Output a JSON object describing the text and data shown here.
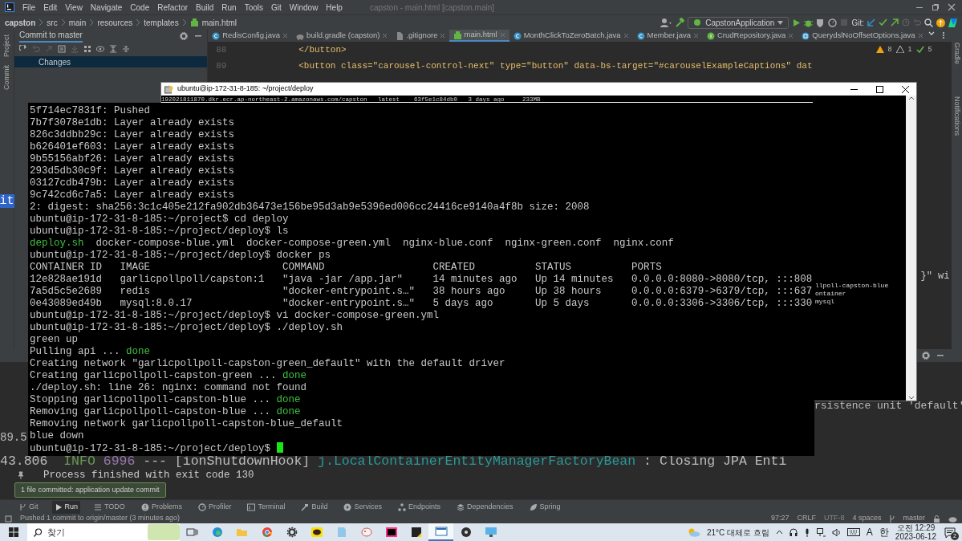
{
  "ide": {
    "menu": [
      "File",
      "Edit",
      "View",
      "Navigate",
      "Code",
      "Refactor",
      "Build",
      "Run",
      "Tools",
      "Git",
      "Window",
      "Help"
    ],
    "window_title": "capston - main.html [capston.main]",
    "breadcrumb": [
      "capston",
      "src",
      "main",
      "resources",
      "templates",
      "main.html"
    ],
    "run_config": "CapstonApplication",
    "git_label": "Git:",
    "left_stripe": [
      "Project",
      "Commit"
    ],
    "commit_panel": {
      "title": "Commit to master",
      "changes": {
        "label": "Changes",
        "selected": true
      },
      "fragment": "it"
    },
    "editor_tabs": [
      {
        "label": "RedisConfig.java",
        "kind": "class",
        "selected": false
      },
      {
        "label": "build.gradle (capston)",
        "kind": "gradle",
        "selected": false
      },
      {
        "label": ".gitignore",
        "kind": "file",
        "selected": false
      },
      {
        "label": "main.html",
        "kind": "html",
        "selected": true
      },
      {
        "label": "MonthClickToZeroBatch.java",
        "kind": "class",
        "selected": false
      },
      {
        "label": "Member.java",
        "kind": "class",
        "selected": false
      },
      {
        "label": "CrudRepository.java",
        "kind": "interface",
        "selected": false
      },
      {
        "label": "QuerydslNoOffsetOptions.java",
        "kind": "annotation",
        "selected": false
      }
    ],
    "inspections": [
      {
        "kind": "warning",
        "count": "8"
      },
      {
        "kind": "weak",
        "count": "1"
      },
      {
        "kind": "ok",
        "count": "5"
      }
    ],
    "code_lines": [
      {
        "number": "88",
        "code": "</button>"
      },
      {
        "number": "89",
        "code": "<button class=\"carousel-control-next\" type=\"button\" data-bs-target=\"#carouselExampleCaptions\" dat"
      }
    ],
    "code_fragment": "}\" wi",
    "right_stripe": [
      "Gradle",
      "Notifications"
    ],
    "run_log": [
      {
        "segments": [
          {
            "text": "rsistence unit 'default'",
            "kind": "plain"
          }
        ]
      },
      {
        "segments": [
          {
            "text": "89.5",
            "kind": "plain"
          }
        ]
      },
      {
        "segments": [
          {
            "text": "43.806  ",
            "kind": "plain"
          },
          {
            "text": "INFO",
            "kind": "info"
          },
          {
            "text": " 6996",
            "kind": "pid"
          },
          {
            "text": " --- [ionShutdownHook] ",
            "kind": "plain"
          },
          {
            "text": "j.LocalContainerEntityManagerFactoryBean",
            "kind": "logger"
          },
          {
            "text": " : Closing JPA Enti",
            "kind": "plain"
          }
        ]
      }
    ],
    "run_output": "Process finished with exit code 130",
    "tooltip": "1 file committed: application update commit",
    "tool_windows": [
      {
        "label": "Git",
        "kind": "git",
        "selected": false
      },
      {
        "label": "Run",
        "kind": "run",
        "selected": true
      },
      {
        "label": "TODO",
        "kind": "todo",
        "selected": false
      },
      {
        "label": "Problems",
        "kind": "problems",
        "selected": false
      },
      {
        "label": "Profiler",
        "kind": "profiler",
        "selected": false
      },
      {
        "label": "Terminal",
        "kind": "terminal",
        "selected": false
      },
      {
        "label": "Build",
        "kind": "build",
        "selected": false
      },
      {
        "label": "Services",
        "kind": "services",
        "selected": false
      },
      {
        "label": "Endpoints",
        "kind": "endpoints",
        "selected": false
      },
      {
        "label": "Dependencies",
        "kind": "dependencies",
        "selected": false
      },
      {
        "label": "Spring",
        "kind": "spring",
        "selected": false
      }
    ],
    "status_message": "Pushed 1 commit to origin/master (3 minutes ago)",
    "status_items": [
      {
        "text": "97:27",
        "disabled": false
      },
      {
        "text": "CRLF",
        "disabled": false
      },
      {
        "text": "UTF-8",
        "disabled": true
      },
      {
        "text": "4 spaces",
        "disabled": false
      },
      {
        "text": "master",
        "disabled": false
      }
    ]
  },
  "terminal": {
    "title": "ubuntu@ip-172-31-8-185: ~/project/deploy",
    "header_line": "192021811870.dkr.ecr.ap-northeast-2.amazonaws.com/capston   latest    63f5e1c84db0   3 days ago     233MB",
    "side_fragments": [
      "llpoll-capston-blue",
      "ontainer",
      "mysql"
    ],
    "lines": [
      {
        "segments": [
          {
            "text": "5f714ec7831f: Pushed",
            "kind": "plain"
          }
        ]
      },
      {
        "segments": [
          {
            "text": "7b7f3078e1db: Layer already exists",
            "kind": "plain"
          }
        ]
      },
      {
        "segments": [
          {
            "text": "826c3ddbb29c: Layer already exists",
            "kind": "plain"
          }
        ]
      },
      {
        "segments": [
          {
            "text": "b626401ef603: Layer already exists",
            "kind": "plain"
          }
        ]
      },
      {
        "segments": [
          {
            "text": "9b55156abf26: Layer already exists",
            "kind": "plain"
          }
        ]
      },
      {
        "segments": [
          {
            "text": "293d5db30c9f: Layer already exists",
            "kind": "plain"
          }
        ]
      },
      {
        "segments": [
          {
            "text": "03127cdb479b: Layer already exists",
            "kind": "plain"
          }
        ]
      },
      {
        "segments": [
          {
            "text": "9c742cd6c7a5: Layer already exists",
            "kind": "plain"
          }
        ]
      },
      {
        "segments": [
          {
            "text": "2: digest: sha256:3c1c405e212fa902db36473e156be95d3ab9e5396ed006cc24416ce9140a4f8b size: 2008",
            "kind": "plain"
          }
        ]
      },
      {
        "segments": [
          {
            "text": "ubuntu@ip-172-31-8-185:~/project$ cd deploy",
            "kind": "plain"
          }
        ]
      },
      {
        "segments": [
          {
            "text": "ubuntu@ip-172-31-8-185:~/project/deploy$ ls",
            "kind": "plain"
          }
        ]
      },
      {
        "segments": [
          {
            "text": "deploy.sh",
            "kind": "ok"
          },
          {
            "text": "  docker-compose-blue.yml  docker-compose-green.yml  nginx-blue.conf  nginx-green.conf  nginx.conf",
            "kind": "plain"
          }
        ]
      },
      {
        "segments": [
          {
            "text": "ubuntu@ip-172-31-8-185:~/project/deploy$ docker ps",
            "kind": "plain"
          }
        ]
      },
      {
        "segments": [
          {
            "text": "CONTAINER ID   IMAGE                      COMMAND                  CREATED          STATUS          PORTS",
            "kind": "plain"
          }
        ]
      },
      {
        "segments": [
          {
            "text": "12e828ae191d   garlicpollpoll/capston:1   \"java -jar /app.jar\"     14 minutes ago   Up 14 minutes   0.0.0.0:8080->8080/tcp, :::808",
            "kind": "plain"
          }
        ]
      },
      {
        "segments": [
          {
            "text": "7a5d5c5e2689   redis                      \"docker-entrypoint.s…\"   38 hours ago     Up 38 hours     0.0.0.0:6379->6379/tcp, :::637",
            "kind": "plain"
          }
        ]
      },
      {
        "segments": [
          {
            "text": "0e43089ed49b   mysql:8.0.17               \"docker-entrypoint.s…\"   5 days ago       Up 5 days       0.0.0.0:3306->3306/tcp, :::330",
            "kind": "plain"
          }
        ]
      },
      {
        "segments": [
          {
            "text": "ubuntu@ip-172-31-8-185:~/project/deploy$ vi docker-compose-green.yml",
            "kind": "plain"
          }
        ]
      },
      {
        "segments": [
          {
            "text": "ubuntu@ip-172-31-8-185:~/project/deploy$ ./deploy.sh",
            "kind": "plain"
          }
        ]
      },
      {
        "segments": [
          {
            "text": "green up",
            "kind": "plain"
          }
        ]
      },
      {
        "segments": [
          {
            "text": "Pulling api ... ",
            "kind": "plain"
          },
          {
            "text": "done",
            "kind": "ok"
          }
        ]
      },
      {
        "segments": [
          {
            "text": "Creating network \"garlicpollpoll-capston-green_default\" with the default driver",
            "kind": "plain"
          }
        ]
      },
      {
        "segments": [
          {
            "text": "Creating garlicpollpoll-capston-green ... ",
            "kind": "plain"
          },
          {
            "text": "done",
            "kind": "ok"
          }
        ]
      },
      {
        "segments": [
          {
            "text": "./deploy.sh: line 26: nginx: command not found",
            "kind": "plain"
          }
        ]
      },
      {
        "segments": [
          {
            "text": "Stopping garlicpollpoll-capston-blue ... ",
            "kind": "plain"
          },
          {
            "text": "done",
            "kind": "ok"
          }
        ]
      },
      {
        "segments": [
          {
            "text": "Removing garlicpollpoll-capston-blue ... ",
            "kind": "plain"
          },
          {
            "text": "done",
            "kind": "ok"
          }
        ]
      },
      {
        "segments": [
          {
            "text": "Removing network garlicpollpoll-capston-blue_default",
            "kind": "plain"
          }
        ]
      },
      {
        "segments": [
          {
            "text": "blue down",
            "kind": "plain"
          }
        ]
      },
      {
        "segments": [
          {
            "text": "ubuntu@ip-172-31-8-185:~/project/deploy$ ",
            "kind": "plain"
          }
        ],
        "cursor": true
      }
    ]
  },
  "taskbar": {
    "search_placeholder": "찾기",
    "apps": [
      {
        "kind": "taskview",
        "selected": false
      },
      {
        "kind": "edge",
        "selected": false
      },
      {
        "kind": "explorer",
        "selected": false
      },
      {
        "kind": "chrome",
        "selected": false
      },
      {
        "kind": "settings",
        "selected": false
      },
      {
        "kind": "kakaotalk",
        "selected": false
      },
      {
        "kind": "notepad",
        "selected": false
      },
      {
        "kind": "paint",
        "selected": false
      },
      {
        "kind": "intellij",
        "selected": false
      },
      {
        "kind": "sticky",
        "selected": false
      },
      {
        "kind": "window",
        "selected": true
      },
      {
        "kind": "obs",
        "selected": false
      },
      {
        "kind": "remote",
        "selected": false
      }
    ],
    "weather": "21°C 대체로 흐림",
    "ime": [
      "A",
      "한"
    ],
    "time": "오전 12:29",
    "date": "2023-06-12",
    "notification_count": "2"
  }
}
